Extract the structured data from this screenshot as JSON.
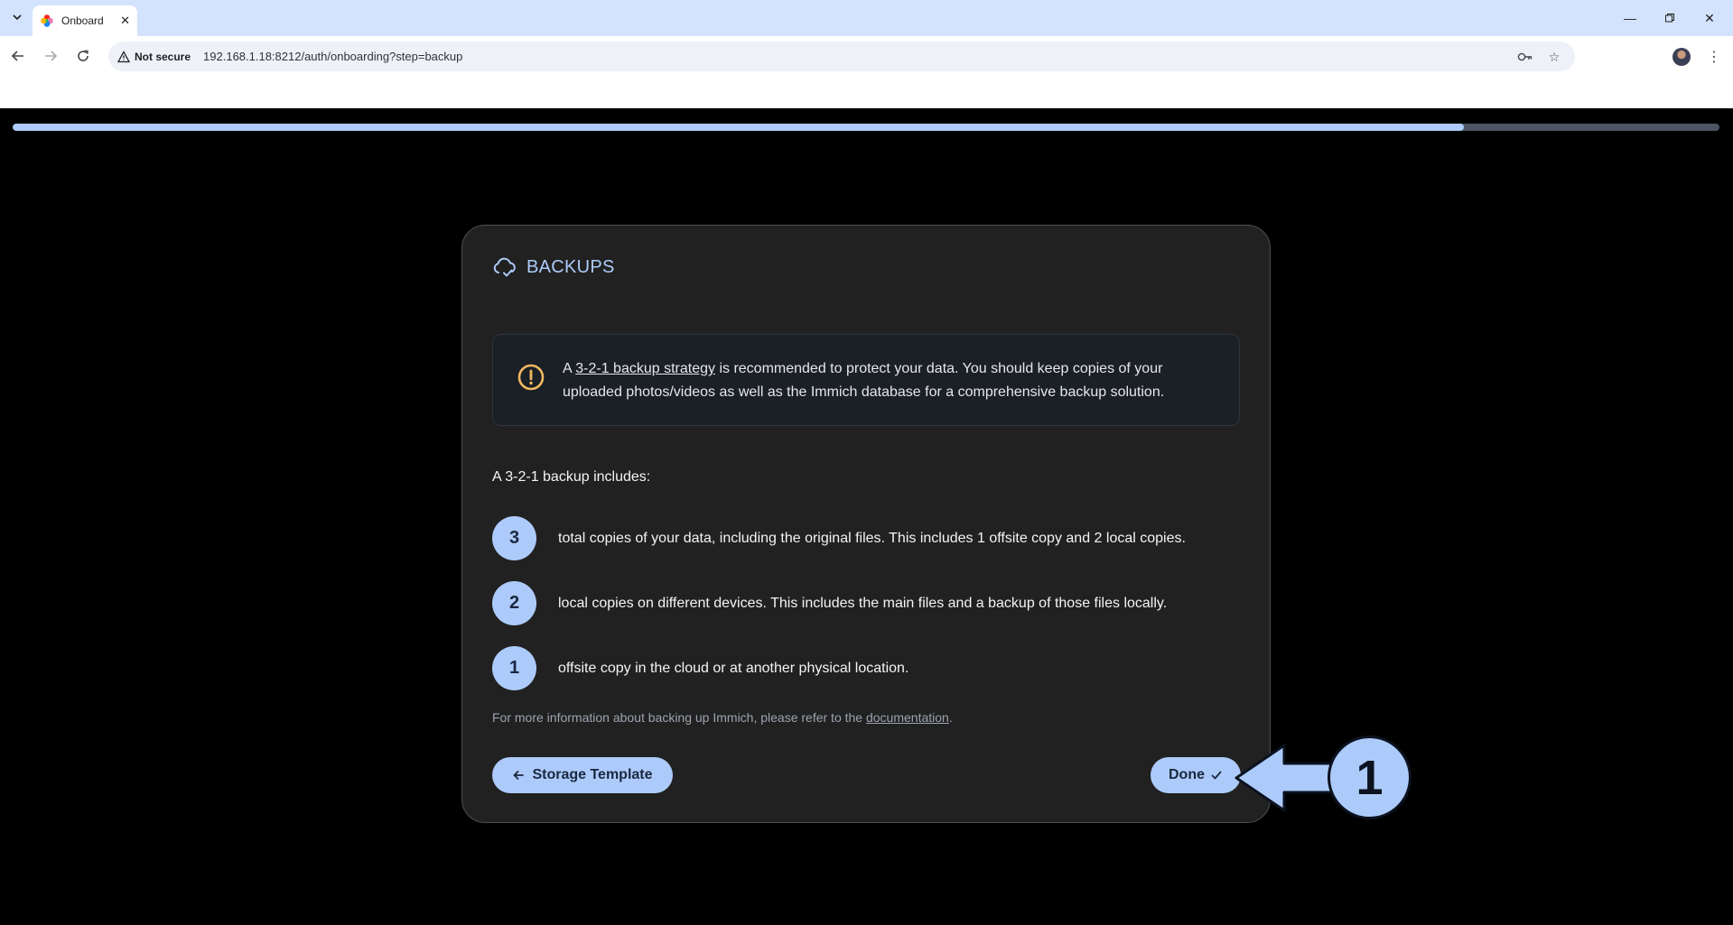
{
  "browser": {
    "tab_title": "Onboard",
    "security_label": "Not secure",
    "url": "192.168.1.18:8212/auth/onboarding?step=backup"
  },
  "onboarding": {
    "progress": 0.85,
    "card": {
      "title": "BACKUPS",
      "alert": {
        "prefix": "A",
        "link_text": "3-2-1 backup strategy",
        "suffix": "is recommended to protect your data. You should keep copies of your uploaded photos/videos as well as the Immich database for a comprehensive backup solution."
      },
      "includes_title": "A 3-2-1 backup includes:",
      "items": [
        {
          "number": "3",
          "text": "total copies of your data, including the original files. This includes 1 offsite copy and 2 local copies."
        },
        {
          "number": "2",
          "text": "local copies on different devices. This includes the main files and a backup of those files locally."
        },
        {
          "number": "1",
          "text": "offsite copy in the cloud or at another physical location."
        }
      ],
      "footnote": {
        "prefix": "For more information about backing up Immich, please refer to the",
        "link_text": "documentation",
        "suffix": "."
      },
      "back_button": "Storage Template",
      "done_button": "Done"
    }
  },
  "annotation": {
    "step_number": "1",
    "color": "#adcbfa"
  }
}
